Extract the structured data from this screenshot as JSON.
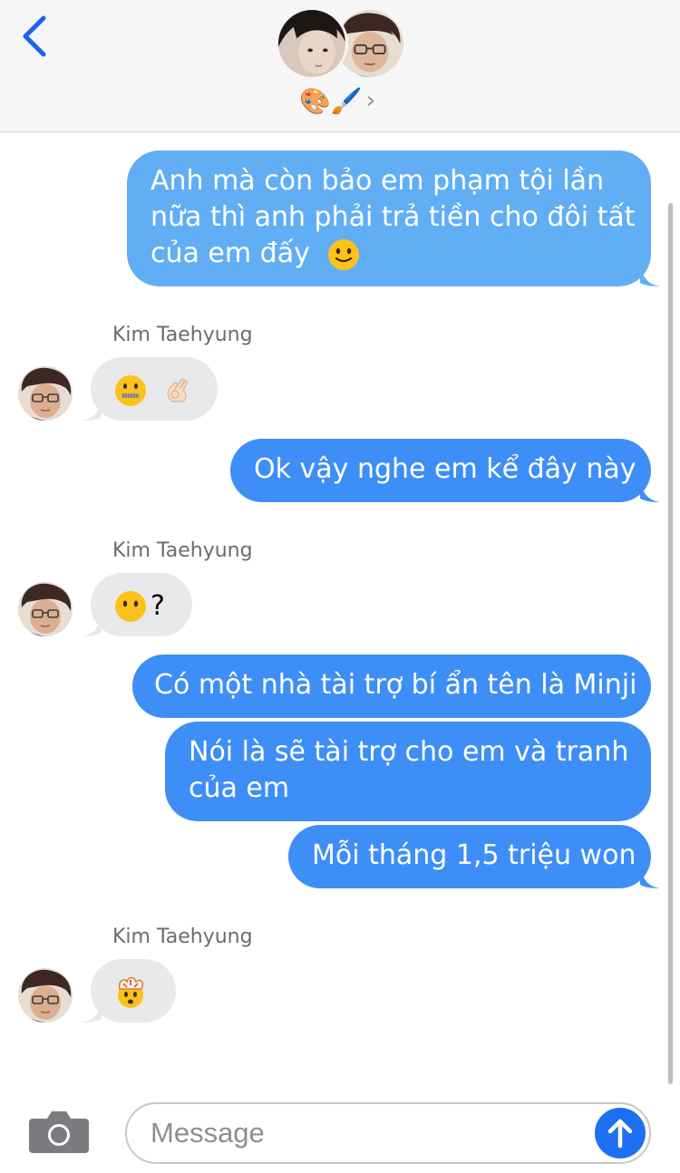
{
  "header": {
    "back_icon": "chevron-left-icon",
    "group_name": "🎨🖌️",
    "chevron": "›"
  },
  "messages": {
    "m1": {
      "lines": [
        "Anh mà còn bảo em phạm tội lần",
        "nữa thì anh phải trả tiền cho đôi tất",
        "của em đấy"
      ],
      "emoji": "slightly-smiling-face"
    },
    "sender_1": "Kim Taehyung",
    "m2": {
      "emojis": [
        "zipper-mouth-face",
        "ok-hand-light-skin"
      ]
    },
    "m3": "Ok vậy nghe em kể đây này",
    "sender_2": "Kim Taehyung",
    "m4": {
      "emoji": "face-without-mouth",
      "text": "?"
    },
    "m5": "Có một nhà tài trợ bí ẩn tên là Minji",
    "m6": {
      "lines": [
        "Nói là sẽ tài trợ cho em và tranh",
        "của em"
      ]
    },
    "m7": "Mỗi tháng 1,5 triệu won",
    "sender_3": "Kim Taehyung",
    "m8": {
      "emoji": "exploding-head"
    }
  },
  "composer": {
    "placeholder": "Message",
    "camera_icon": "camera-icon",
    "send_icon": "arrow-up-icon"
  },
  "colors": {
    "sent_bubble": "#3e8ef7",
    "sent_bubble_top": "#62aef4",
    "received_bubble": "#e9e9eb",
    "accent": "#1e6ff1"
  }
}
